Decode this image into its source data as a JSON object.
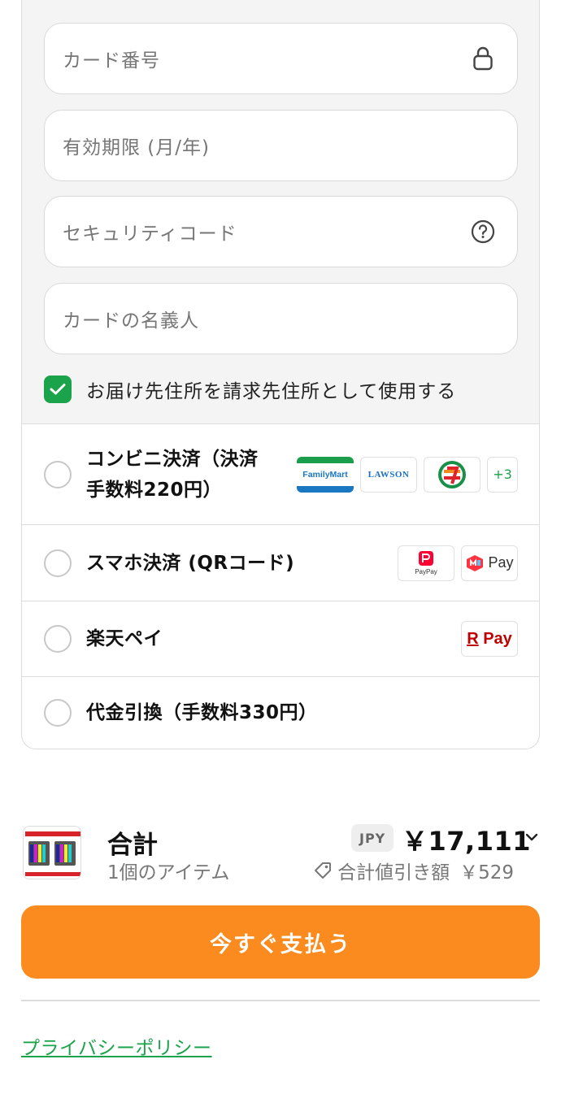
{
  "card_form": {
    "card_number_placeholder": "カード番号",
    "expiry_placeholder": "有効期限 (月/年)",
    "security_code_placeholder": "セキュリティコード",
    "cardholder_placeholder": "カードの名義人",
    "billing_same_label": "お届け先住所を請求先住所として使用する",
    "billing_same_checked": true
  },
  "payment_methods": [
    {
      "label_line1": "コンビニ決済（決済",
      "label_line2": "手数料220円）",
      "logos": [
        "FamilyMart",
        "LAWSON",
        "7-Eleven"
      ],
      "more": "+3"
    },
    {
      "label": "スマホ決済 (QRコード)",
      "logos": [
        "PayPay",
        "merpay"
      ],
      "paypay_text": "PayPay",
      "merpay_text": "Pay"
    },
    {
      "label": "楽天ペイ",
      "rpay_r": "R",
      "rpay_text": "Pay"
    },
    {
      "label": "代金引換（手数料330円）"
    }
  ],
  "logo_text": {
    "familymart": "FamilyMart",
    "lawson": "LAWSON"
  },
  "summary": {
    "title": "合計",
    "items": "1個のアイテム",
    "currency": "JPY",
    "total": "￥17,111",
    "discount_label": "合計値引き額",
    "discount_amount": "￥529"
  },
  "pay_button": "今すぐ支払う",
  "privacy_link": "プライバシーポリシー",
  "colors": {
    "accent_orange": "#fb8b1e",
    "accent_green": "#1aa34a"
  }
}
